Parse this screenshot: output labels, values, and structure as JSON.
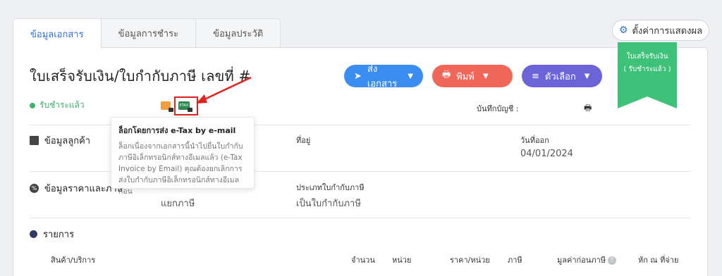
{
  "tabs": [
    "ข้อมูลเอกสาร",
    "ข้อมูลการชำระ",
    "ข้อมูลประวัติ"
  ],
  "settings_label": "ตั้งค่าการแสดงผล",
  "doc_title": "ใบเสร็จรับเงิน/ใบกำกับภาษี เลขที่ #",
  "buttons": {
    "send": "ส่งเอกสาร",
    "print": "พิมพ์",
    "options": "ตัวเลือก"
  },
  "ribbon": {
    "line1": "ใบเสร็จรับเงิน",
    "line2": "( รับชำระแล้ว )"
  },
  "status": "รับชำระแล้ว",
  "book_label": "บันทึกบัญชี :",
  "tooltip": {
    "title": "ล็อกโดยการส่ง e-Tax by e-mail",
    "body": "ล็อกเนื่องจากเอกสารนี้นำไปยื่นใบกำกับภาษีอิเล็กทรอนิกส์ทางอีเมลแล้ว (e-Tax Invoice by Email) คุณต้องยกเลิกการส่งใบกำกับภาษีอิเล็กทรอนิกส์ทางอีเมลก่อน"
  },
  "customer_section": "ข้อมูลลูกค้า",
  "address_label": "ที่อยู่",
  "issue_date_label": "วันที่ออก",
  "issue_date": "04/01/2024",
  "price_section": "ข้อมูลราคาและภาษี",
  "tax_mode": "แยกภาษี",
  "invoice_type_label": "ประเภทใบกำกับภาษี",
  "invoice_type": "เป็นใบกำกับภาษี",
  "items_section": "รายการ",
  "columns": [
    "สินค้า/บริการ",
    "จำนวน",
    "หน่วย",
    "ราคา/หน่วย",
    "ภาษี",
    "มูลค่าก่อนภาษี",
    "หัก ณ ที่จ่าย"
  ],
  "accent_color": "#2e6fd8",
  "icons": [
    "gear-icon",
    "send-icon",
    "printer-icon",
    "menu-icon",
    "lock-icon",
    "building-icon",
    "percent-icon",
    "help-icon"
  ]
}
